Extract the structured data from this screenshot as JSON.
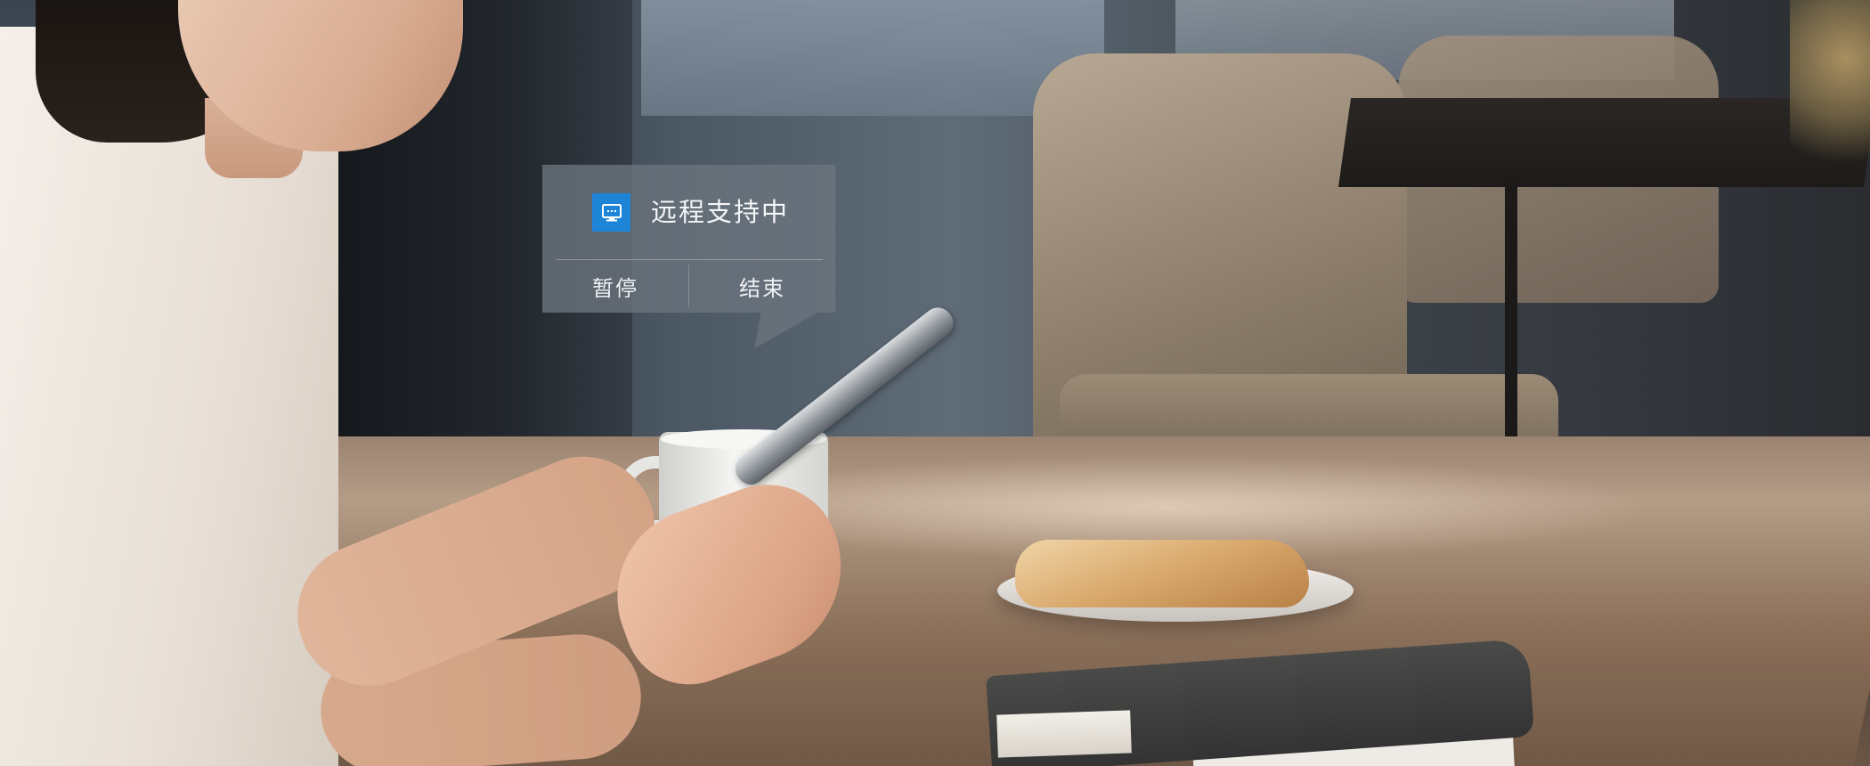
{
  "popup": {
    "status_icon": "remote-desktop-icon",
    "status_text": "远程支持中",
    "actions": {
      "pause_label": "暂停",
      "end_label": "结束"
    }
  },
  "colors": {
    "accent": "#1e84d8",
    "popup_background": "#6c747e",
    "popup_text": "#f4f6f8"
  }
}
